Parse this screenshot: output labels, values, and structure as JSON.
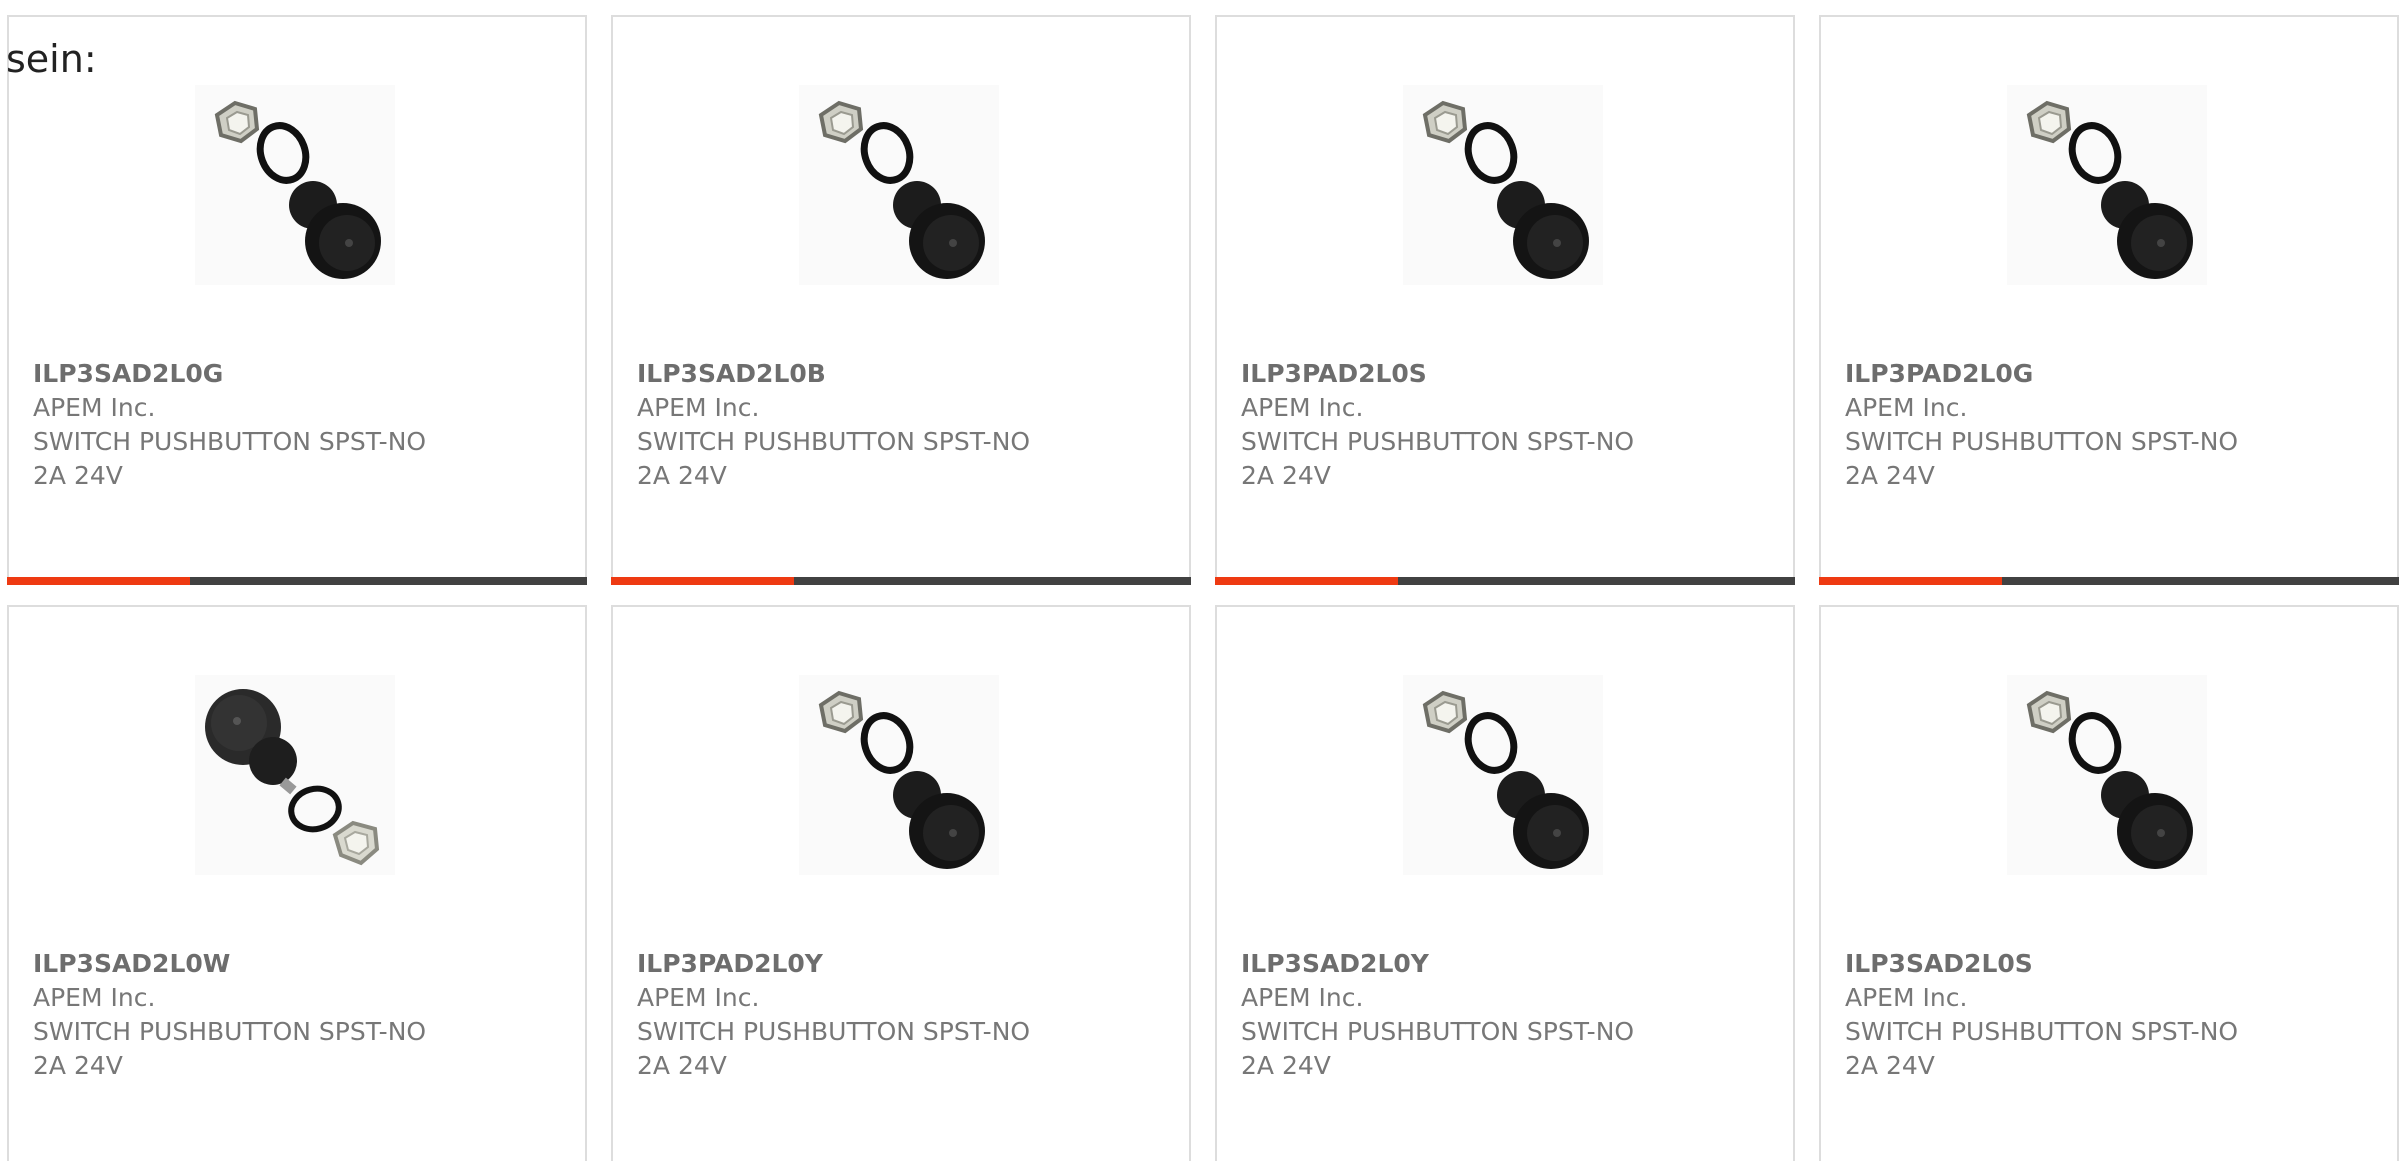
{
  "intro_text": "sein:",
  "products": [
    {
      "part": "ILP3SAD2L0G",
      "manufacturer": "APEM Inc.",
      "desc1": "SWITCH PUSHBUTTON SPST-NO",
      "desc2": "2A 24V",
      "image": "pushbutton-switch-icon"
    },
    {
      "part": "ILP3SAD2L0B",
      "manufacturer": "APEM Inc.",
      "desc1": "SWITCH PUSHBUTTON SPST-NO",
      "desc2": "2A 24V",
      "image": "pushbutton-switch-icon"
    },
    {
      "part": "ILP3PAD2L0S",
      "manufacturer": "APEM Inc.",
      "desc1": "SWITCH PUSHBUTTON SPST-NO",
      "desc2": "2A 24V",
      "image": "pushbutton-switch-icon"
    },
    {
      "part": "ILP3PAD2L0G",
      "manufacturer": "APEM Inc.",
      "desc1": "SWITCH PUSHBUTTON SPST-NO",
      "desc2": "2A 24V",
      "image": "pushbutton-switch-icon"
    },
    {
      "part": "ILP3SAD2L0W",
      "manufacturer": "APEM Inc.",
      "desc1": "SWITCH PUSHBUTTON SPST-NO",
      "desc2": "2A 24V",
      "image": "pushbutton-switch-reversed-icon"
    },
    {
      "part": "ILP3PAD2L0Y",
      "manufacturer": "APEM Inc.",
      "desc1": "SWITCH PUSHBUTTON SPST-NO",
      "desc2": "2A 24V",
      "image": "pushbutton-switch-icon"
    },
    {
      "part": "ILP3SAD2L0Y",
      "manufacturer": "APEM Inc.",
      "desc1": "SWITCH PUSHBUTTON SPST-NO",
      "desc2": "2A 24V",
      "image": "pushbutton-switch-icon"
    },
    {
      "part": "ILP3SAD2L0S",
      "manufacturer": "APEM Inc.",
      "desc1": "SWITCH PUSHBUTTON SPST-NO",
      "desc2": "2A 24V",
      "image": "pushbutton-switch-icon"
    }
  ],
  "colors": {
    "accent": "#ee3a12",
    "bar": "#414141",
    "border": "#dddddd",
    "text": "#777777"
  }
}
